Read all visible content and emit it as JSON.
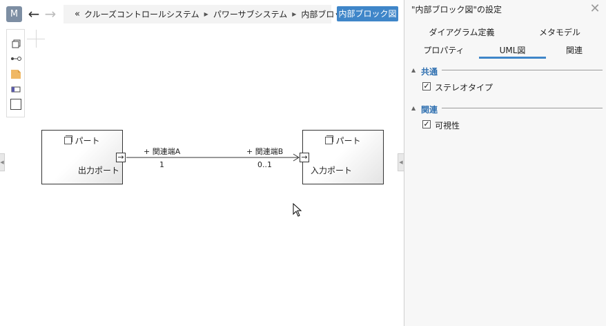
{
  "toolbar": {
    "model_button": "M",
    "back_icon": "←",
    "forward_icon": "→",
    "diagram_button": "内部ブロック図"
  },
  "breadcrumb": {
    "lead": "«",
    "items": [
      "クルーズコントロールシステム",
      "パワーサブシステム",
      "内部ブロック図"
    ]
  },
  "palette": {
    "items": [
      "block-icon",
      "connector-icon",
      "note-icon",
      "port-icon",
      "frame-icon"
    ]
  },
  "diagram": {
    "left_part": {
      "label": "パート",
      "port_label": "出力ポート"
    },
    "right_part": {
      "label": "パート",
      "port_label": "入力ポート"
    },
    "connector": {
      "end_a_name": "+ 関連端A",
      "end_a_mult": "1",
      "end_b_name": "+ 関連端B",
      "end_b_mult": "0..1"
    }
  },
  "panel": {
    "title": "\"内部ブロック図\"の設定",
    "close": "✕",
    "tabs_row1": [
      "ダイアグラム定義",
      "メタモデル"
    ],
    "tabs_row2": [
      "プロパティ",
      "UML図",
      "関連"
    ],
    "active_tab": "UML図",
    "sections": [
      {
        "title": "共通",
        "options": [
          {
            "label": "ステレオタイプ",
            "checked": true
          }
        ]
      },
      {
        "title": "関連",
        "options": [
          {
            "label": "可視性",
            "checked": true
          }
        ]
      }
    ]
  },
  "colors": {
    "accent": "#3f86c9",
    "model_button": "#7d8ea3",
    "section_heading": "#2e6fb0"
  }
}
